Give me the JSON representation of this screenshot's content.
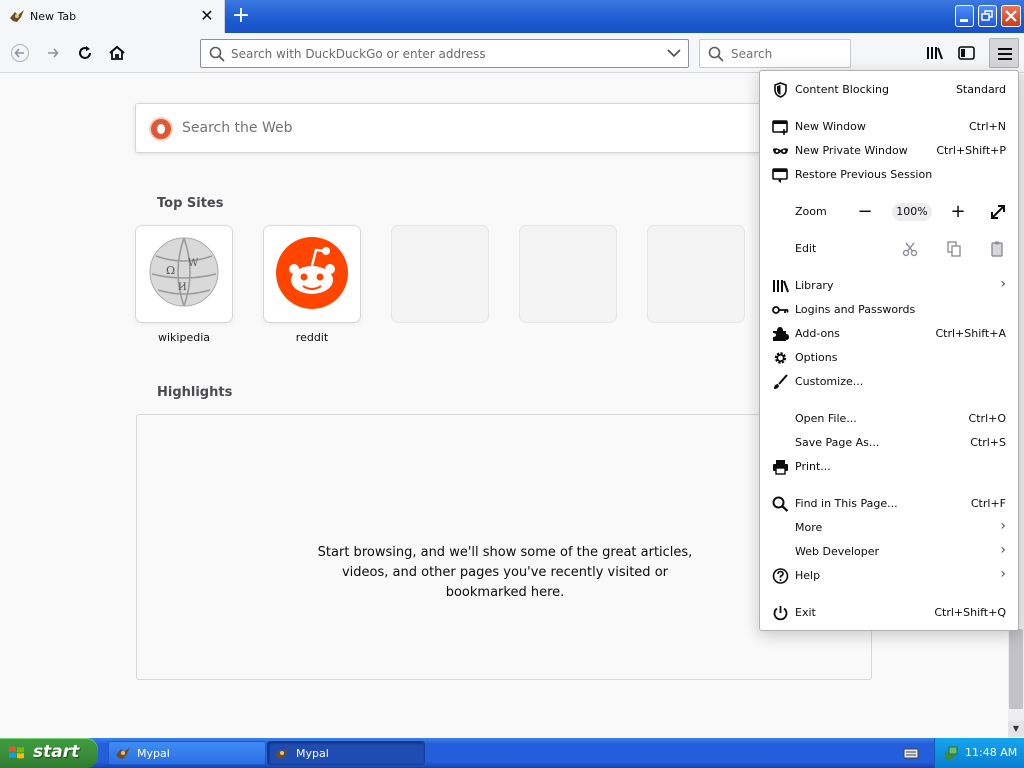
{
  "tab": {
    "title": "New Tab",
    "close_glyph": "✕",
    "new_tab_glyph": "+"
  },
  "window_controls": {
    "minimize": "_",
    "restore": "❐",
    "close": "✕"
  },
  "navbar": {
    "url_placeholder": "Search with DuckDuckGo or enter address",
    "search_placeholder": "Search"
  },
  "newtab": {
    "web_search_placeholder": "Search the Web",
    "top_sites_title": "Top Sites",
    "top_sites": [
      {
        "label": "wikipedia",
        "icon": "wikipedia-globe-icon"
      },
      {
        "label": "reddit",
        "icon": "reddit-alien-icon"
      },
      {
        "label": ""
      },
      {
        "label": ""
      },
      {
        "label": ""
      }
    ],
    "highlights_title": "Highlights",
    "highlights_message": [
      "Start browsing, and we'll show some of the great articles,",
      "videos, and other pages you've recently visited or",
      "bookmarked here."
    ]
  },
  "menu": {
    "content_blocking": {
      "label": "Content Blocking",
      "value": "Standard"
    },
    "new_window": {
      "label": "New Window",
      "shortcut": "Ctrl+N"
    },
    "new_private_window": {
      "label": "New Private Window",
      "shortcut": "Ctrl+Shift+P"
    },
    "restore_session": {
      "label": "Restore Previous Session"
    },
    "zoom": {
      "label": "Zoom",
      "minus": "−",
      "value": "100%",
      "plus": "+"
    },
    "edit": {
      "label": "Edit"
    },
    "library": {
      "label": "Library"
    },
    "logins": {
      "label": "Logins and Passwords"
    },
    "addons": {
      "label": "Add-ons",
      "shortcut": "Ctrl+Shift+A"
    },
    "options": {
      "label": "Options"
    },
    "customize": {
      "label": "Customize..."
    },
    "open_file": {
      "label": "Open File...",
      "shortcut": "Ctrl+O"
    },
    "save_page": {
      "label": "Save Page As...",
      "shortcut": "Ctrl+S"
    },
    "print": {
      "label": "Print..."
    },
    "find": {
      "label": "Find in This Page...",
      "shortcut": "Ctrl+F"
    },
    "more": {
      "label": "More"
    },
    "web_developer": {
      "label": "Web Developer"
    },
    "help": {
      "label": "Help"
    },
    "exit": {
      "label": "Exit",
      "shortcut": "Ctrl+Shift+Q"
    },
    "submenu_arrow": "›"
  },
  "taskbar": {
    "start_label": "start",
    "items": [
      {
        "label": "Mypal"
      },
      {
        "label": "Mypal"
      }
    ],
    "clock": "11:48 AM"
  },
  "colors": {
    "xp_blue": "#245edb",
    "start_green": "#3c8f3c",
    "reddit_orange": "#ff4500",
    "ddg_orange": "#de5833"
  }
}
